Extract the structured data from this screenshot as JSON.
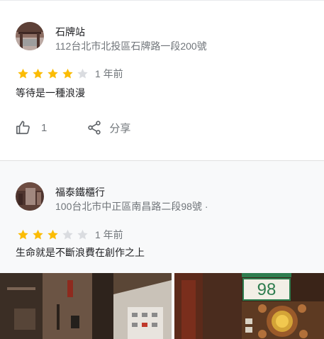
{
  "reviews": [
    {
      "place_name": "石牌站",
      "address": "112台北市北投區石牌路一段200號",
      "rating": 4,
      "max_rating": 5,
      "time": "1 年前",
      "text": "等待是一種浪漫",
      "like_count": "1",
      "share_label": "分享",
      "icons": [
        "thumb-up-icon",
        "share-icon"
      ]
    },
    {
      "place_name": "福泰鐵櫃行",
      "address": "100台北市中正區南昌路二段98號 ·",
      "rating": 3,
      "max_rating": 5,
      "time": "1 年前",
      "text": "生命就是不斷浪費在創作之上",
      "photo_sign_number": "98"
    }
  ],
  "colors": {
    "star_filled": "#fbbc04",
    "star_empty": "#dadce0",
    "secondary_text": "#70757a",
    "primary_text": "#202124"
  }
}
